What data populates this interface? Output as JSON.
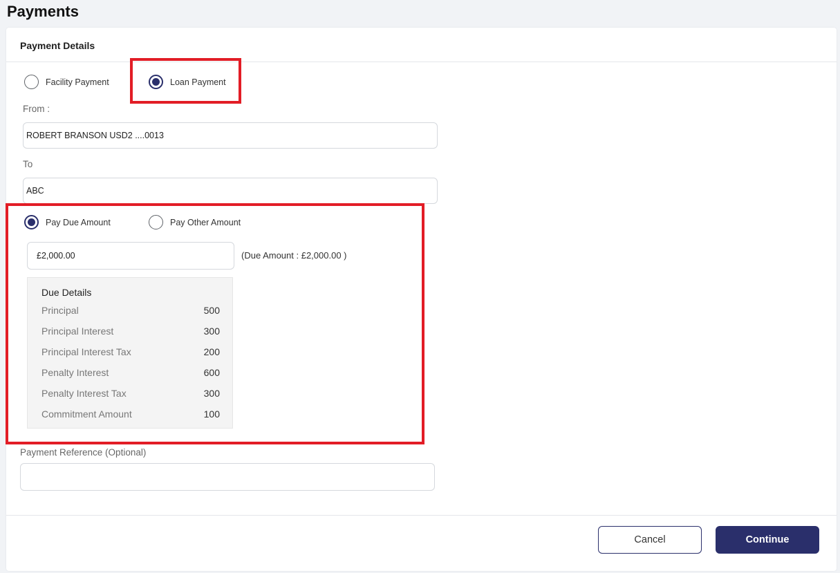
{
  "page": {
    "title": "Payments"
  },
  "card": {
    "title": "Payment Details"
  },
  "payment_type": {
    "options": [
      {
        "label": "Facility Payment",
        "checked": false
      },
      {
        "label": "Loan Payment",
        "checked": true
      }
    ]
  },
  "from": {
    "label": "From :",
    "value": "ROBERT BRANSON USD2 ....0013"
  },
  "to": {
    "label": "To",
    "value": "ABC"
  },
  "amount_type": {
    "options": [
      {
        "label": "Pay Due Amount",
        "checked": true
      },
      {
        "label": "Pay Other Amount",
        "checked": false
      }
    ]
  },
  "amount": {
    "value": "£2,000.00",
    "due_note": "(Due Amount : £2,000.00 )"
  },
  "due_details": {
    "title": "Due Details",
    "rows": [
      {
        "label": "Principal",
        "value": "500"
      },
      {
        "label": "Principal Interest",
        "value": "300"
      },
      {
        "label": "Principal Interest Tax",
        "value": "200"
      },
      {
        "label": "Penalty Interest",
        "value": "600"
      },
      {
        "label": "Penalty Interest Tax",
        "value": "300"
      },
      {
        "label": "Commitment Amount",
        "value": "100"
      }
    ]
  },
  "reference": {
    "label": "Payment Reference (Optional)",
    "value": ""
  },
  "buttons": {
    "cancel": "Cancel",
    "continue": "Continue"
  },
  "colors": {
    "accent": "#2a2f6b",
    "highlight": "#e21d26"
  }
}
